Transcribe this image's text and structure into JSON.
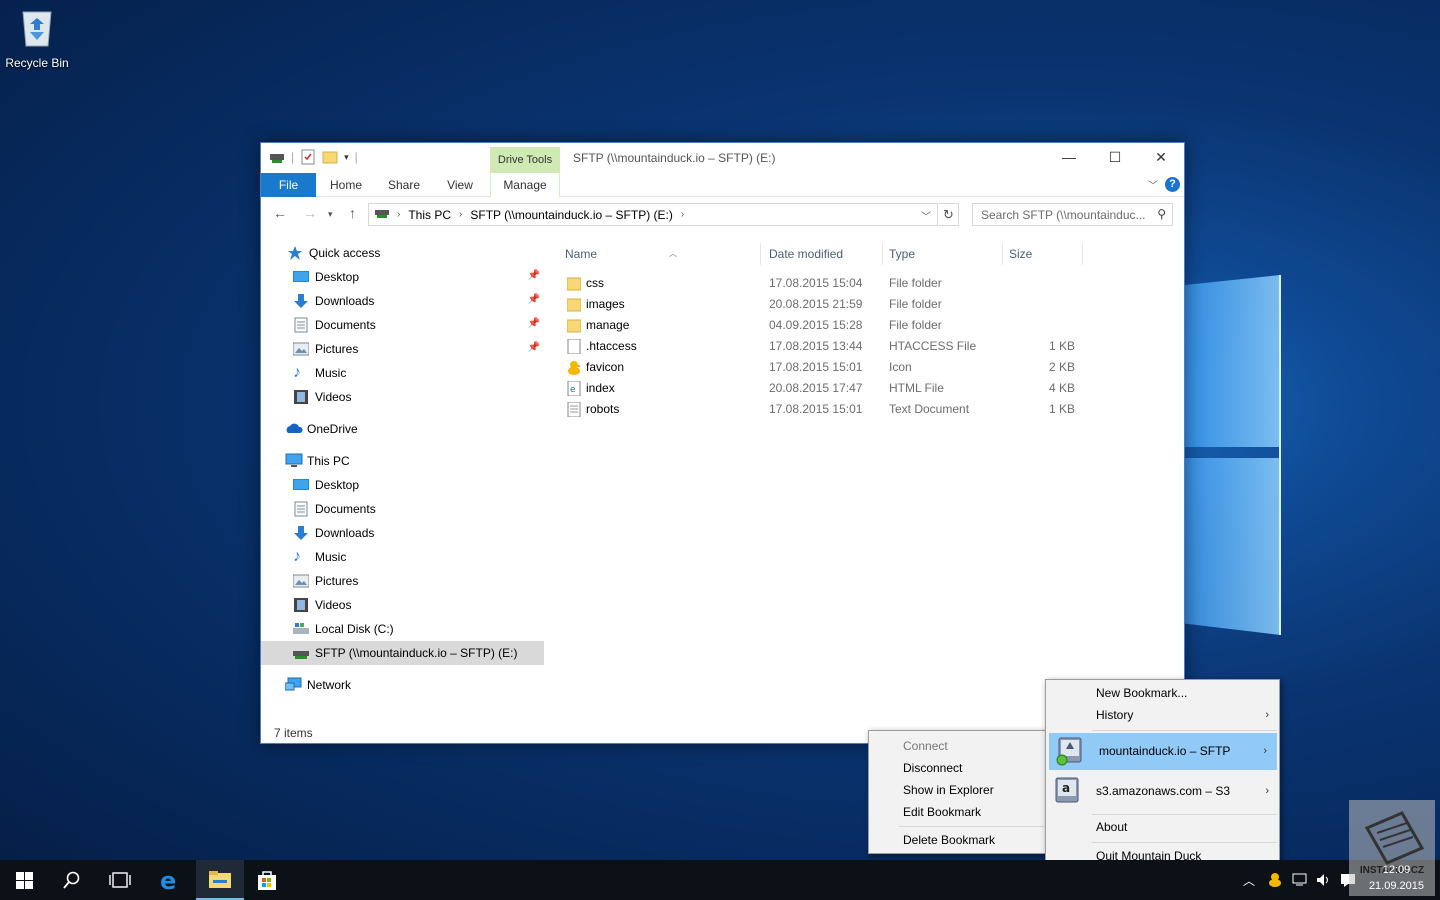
{
  "desktop": {
    "recycle_bin_label": "Recycle Bin"
  },
  "window": {
    "title": "SFTP (\\\\mountainduck.io – SFTP) (E:)",
    "contextual_tab_group": "Drive Tools",
    "ribbon_tabs": [
      "File",
      "Home",
      "Share",
      "View",
      "Manage"
    ],
    "controls": {
      "minimize": "—",
      "maximize": "☐",
      "close": "✕"
    }
  },
  "address": {
    "segments": [
      "This PC",
      "SFTP (\\\\mountainduck.io – SFTP) (E:)"
    ],
    "search_placeholder": "Search SFTP (\\\\mountainduc..."
  },
  "nav": {
    "quick_access": "Quick access",
    "quick_items": [
      "Desktop",
      "Downloads",
      "Documents",
      "Pictures",
      "Music",
      "Videos"
    ],
    "onedrive": "OneDrive",
    "this_pc": "This PC",
    "pc_items": [
      "Desktop",
      "Documents",
      "Downloads",
      "Music",
      "Pictures",
      "Videos",
      "Local Disk (C:)",
      "SFTP (\\\\mountainduck.io – SFTP) (E:)"
    ],
    "network": "Network"
  },
  "columns": [
    "Name",
    "Date modified",
    "Type",
    "Size"
  ],
  "files": [
    {
      "name": "css",
      "date": "17.08.2015 15:04",
      "type": "File folder",
      "size": ""
    },
    {
      "name": "images",
      "date": "20.08.2015 21:59",
      "type": "File folder",
      "size": ""
    },
    {
      "name": "manage",
      "date": "04.09.2015 15:28",
      "type": "File folder",
      "size": ""
    },
    {
      "name": ".htaccess",
      "date": "17.08.2015 13:44",
      "type": "HTACCESS File",
      "size": "1 KB"
    },
    {
      "name": "favicon",
      "date": "17.08.2015 15:01",
      "type": "Icon",
      "size": "2 KB"
    },
    {
      "name": "index",
      "date": "20.08.2015 17:47",
      "type": "HTML File",
      "size": "4 KB"
    },
    {
      "name": "robots",
      "date": "17.08.2015 15:01",
      "type": "Text Document",
      "size": "1 KB"
    }
  ],
  "status_text": "7 items",
  "tray_menu": {
    "new_bookmark": "New Bookmark...",
    "history": "History",
    "bookmark1": "mountainduck.io – SFTP",
    "bookmark2": "s3.amazonaws.com – S3",
    "about": "About",
    "quit": "Quit Mountain Duck"
  },
  "submenu": {
    "connect": "Connect",
    "disconnect": "Disconnect",
    "show_in_explorer": "Show in Explorer",
    "edit_bookmark": "Edit Bookmark",
    "delete_bookmark": "Delete Bookmark"
  },
  "taskbar": {
    "clock_time": "12:09",
    "clock_date": "21.09.2015",
    "watermark": "INSTALUJ.CZ"
  },
  "colors": {
    "accent": "#1979ca",
    "drive_tools": "#cfeab3",
    "menu_highlight": "#91c9f7"
  }
}
